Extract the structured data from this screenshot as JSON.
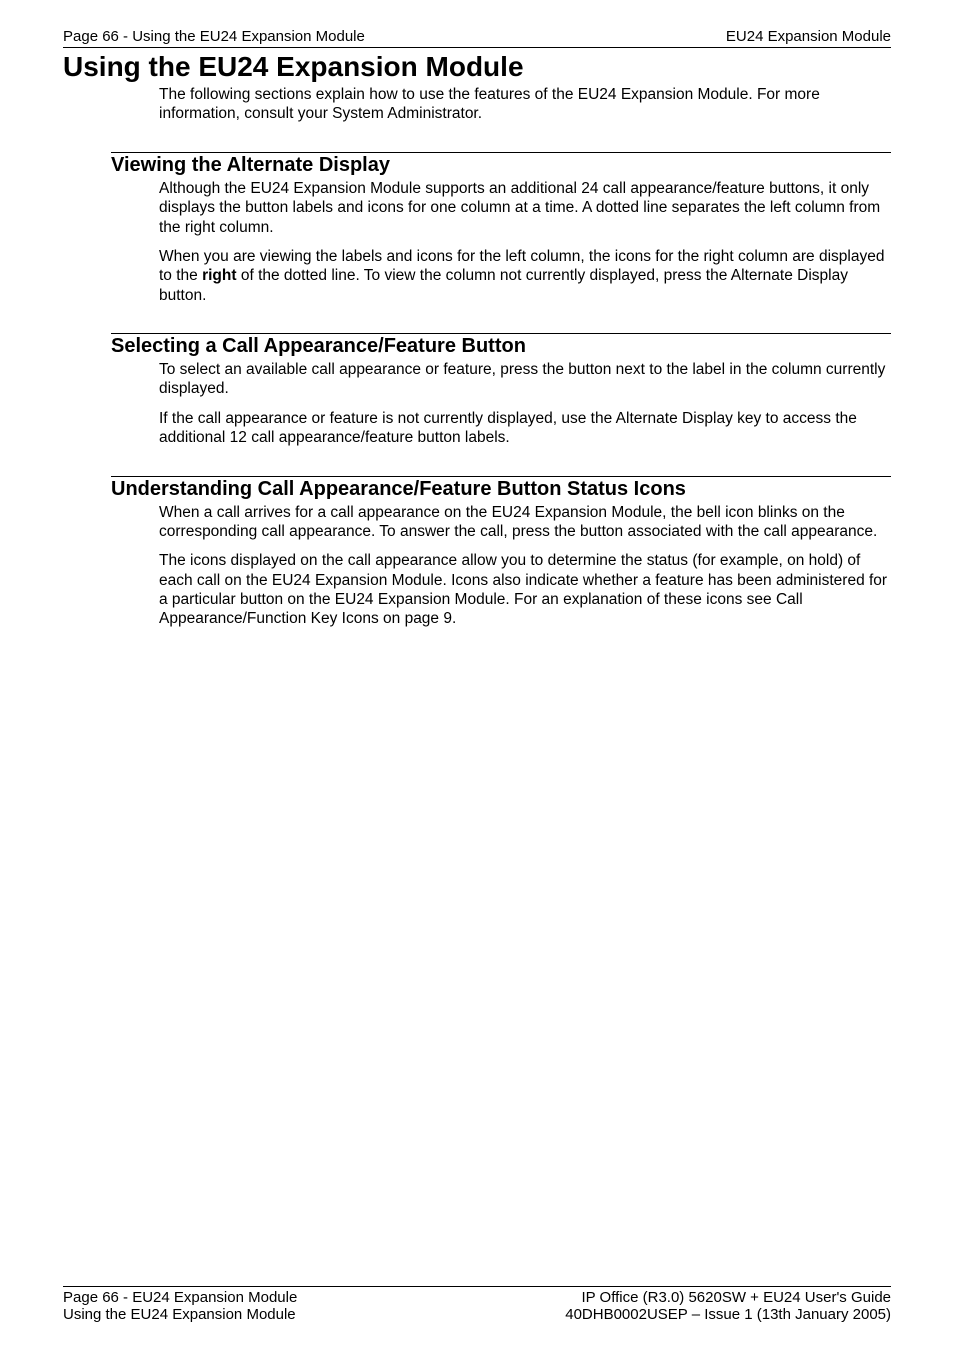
{
  "header": {
    "left": "Page 66 - Using the EU24 Expansion Module",
    "right": "EU24 Expansion Module"
  },
  "title": "Using the EU24 Expansion Module",
  "intro": "The following sections explain how to use the features of the EU24 Expansion Module. For more information, consult your System Administrator.",
  "sections": [
    {
      "heading": "Viewing the Alternate Display",
      "paragraphs": [
        {
          "pre": "Although the EU24 Expansion Module supports an additional 24 call appearance/feature buttons, it only displays the button labels and icons for one column at a time. A dotted line separates the left column from the right column.",
          "bold": "",
          "post": ""
        },
        {
          "pre": "When you are viewing the labels and icons for the left column, the icons for the right column are displayed to the ",
          "bold": "right",
          "post": " of the dotted line. To view the column not currently displayed, press the Alternate Display button."
        }
      ]
    },
    {
      "heading": "Selecting a Call Appearance/Feature Button",
      "paragraphs": [
        {
          "pre": "To select an available call appearance or feature, press the button next to the label in the column currently displayed.",
          "bold": "",
          "post": ""
        },
        {
          "pre": "If the call appearance or feature is not currently displayed, use the Alternate Display key to access the additional 12 call appearance/feature button labels.",
          "bold": "",
          "post": ""
        }
      ]
    },
    {
      "heading": "Understanding Call Appearance/Feature Button Status Icons",
      "paragraphs": [
        {
          "pre": "When a call arrives for a call appearance on the EU24 Expansion Module, the bell icon blinks on the corresponding call appearance. To answer the call, press the button associated with the call appearance.",
          "bold": "",
          "post": ""
        },
        {
          "pre": "The icons displayed on the call appearance allow you to determine the status (for example, on hold) of each call on the EU24 Expansion Module. Icons also indicate whether a feature has been administered for a particular button on the EU24 Expansion Module. For an explanation of these icons see Call Appearance/Function Key Icons on page 9.",
          "bold": "",
          "post": ""
        }
      ]
    }
  ],
  "footer": {
    "leftLine1": "Page 66 - EU24 Expansion Module",
    "leftLine2": "Using the EU24 Expansion Module",
    "rightLine1": "IP Office (R3.0) 5620SW + EU24 User's Guide",
    "rightLine2": "40DHB0002USEP – Issue 1 (13th January 2005)"
  }
}
